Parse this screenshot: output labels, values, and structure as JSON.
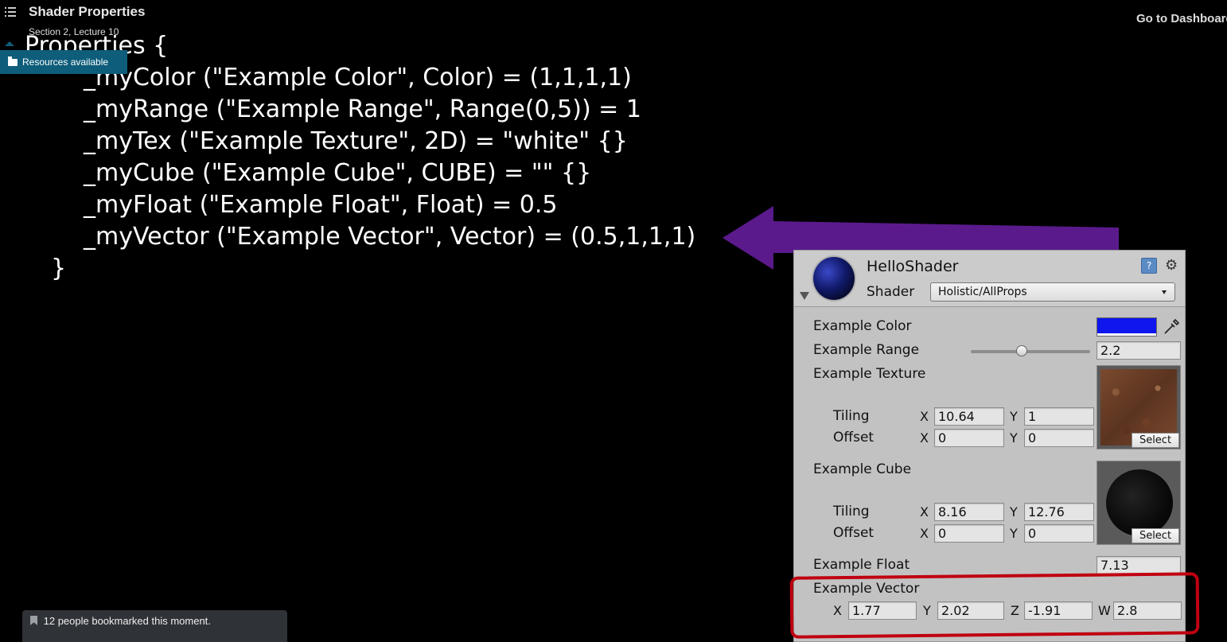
{
  "header": {
    "title": "Shader Properties",
    "subtitle": "Section 2, Lecture 10",
    "dashboard_link": "Go to Dashboard",
    "resources_label": "Resources available"
  },
  "code_lines": [
    "Properties {",
    "_myColor (\"Example Color\", Color) = (1,1,1,1)",
    "_myRange (\"Example Range\", Range(0,5)) = 1",
    "_myTex (\"Example Texture\", 2D) = \"white\" {}",
    "_myCube (\"Example Cube\", CUBE) = \"\" {}",
    "_myFloat (\"Example Float\", Float) = 0.5",
    "_myVector (\"Example Vector\", Vector) = (0.5,1,1,1)",
    "}"
  ],
  "colors": {
    "arrow": "#5a1a8c",
    "highlight": "#c00010",
    "example_color_swatch": "#0f16ee"
  },
  "inspector": {
    "material_name": "HelloShader",
    "shader_label": "Shader",
    "shader_value": "Holistic/AllProps",
    "color_label": "Example Color",
    "range_label": "Example Range",
    "range_value": "2.2",
    "range_fraction": 0.44,
    "texture_label": "Example Texture",
    "tiling_label": "Tiling",
    "offset_label": "Offset",
    "x_label": "X",
    "y_label": "Y",
    "z_label": "Z",
    "w_label": "W",
    "tex_tiling_x": "10.64",
    "tex_tiling_y": "1",
    "tex_offset_x": "0",
    "tex_offset_y": "0",
    "select_label": "Select",
    "cube_label": "Example Cube",
    "cube_tiling_x": "8.16",
    "cube_tiling_y": "12.76",
    "cube_offset_x": "0",
    "cube_offset_y": "0",
    "float_label": "Example Float",
    "float_value": "7.13",
    "vector_label": "Example Vector",
    "vector_x": "1.77",
    "vector_y": "2.02",
    "vector_z": "-1.91",
    "vector_w": "2.8",
    "help_icon": "?"
  },
  "bookmark_note": "12 people bookmarked this moment."
}
